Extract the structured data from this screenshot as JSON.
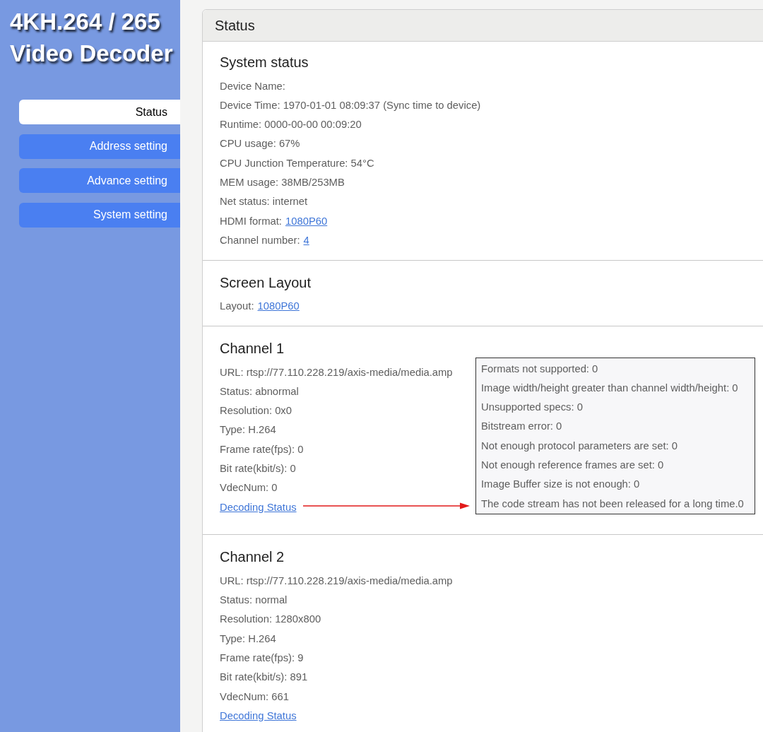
{
  "sidebar": {
    "title_lines": [
      "4KH.264 / 265",
      "Video Decoder"
    ],
    "items": [
      {
        "label": "Status",
        "selected": true
      },
      {
        "label": "Address setting",
        "selected": false
      },
      {
        "label": "Advance setting",
        "selected": false
      },
      {
        "label": "System setting",
        "selected": false
      }
    ]
  },
  "panel": {
    "title": "Status",
    "sections": [
      {
        "heading": "System status",
        "rows": [
          {
            "kind": "text",
            "text": "Device Name:"
          },
          {
            "kind": "text",
            "text": "Device Time: 1970-01-01 08:09:37 (Sync time to device)"
          },
          {
            "kind": "text",
            "text": "Runtime: 0000-00-00 00:09:20"
          },
          {
            "kind": "text",
            "text": "CPU usage: 67%"
          },
          {
            "kind": "text",
            "text": "CPU Junction Temperature: 54°C"
          },
          {
            "kind": "text",
            "text": "MEM usage: 38MB/253MB"
          },
          {
            "kind": "text",
            "text": "Net status: internet"
          },
          {
            "kind": "labeled_link",
            "label": "HDMI format:",
            "link": "1080P60"
          },
          {
            "kind": "labeled_link",
            "label": "Channel number:",
            "link": "4"
          }
        ]
      },
      {
        "heading": "Screen Layout",
        "rows": [
          {
            "kind": "labeled_link",
            "label": "Layout:",
            "link": "1080P60"
          }
        ]
      },
      {
        "heading": "Channel 1",
        "rows": [
          {
            "kind": "text",
            "text": "URL: rtsp://77.110.228.219/axis-media/media.amp"
          },
          {
            "kind": "text",
            "text": "Status: abnormal"
          },
          {
            "kind": "text",
            "text": "Resolution: 0x0"
          },
          {
            "kind": "text",
            "text": "Type: H.264"
          },
          {
            "kind": "text",
            "text": "Frame rate(fps): 0"
          },
          {
            "kind": "text",
            "text": "Bit rate(kbit/s): 0"
          },
          {
            "kind": "text",
            "text": "VdecNum: 0"
          },
          {
            "kind": "link",
            "link": "Decoding Status"
          }
        ],
        "decoding_popup": {
          "lines": [
            "Formats not supported: 0",
            "Image width/height greater than channel width/height: 0",
            "Unsupported specs: 0",
            "Bitstream error: 0",
            "Not enough protocol parameters are set: 0",
            "Not enough reference frames are set: 0",
            "Image Buffer size is not enough: 0",
            "The code stream has not been released for a long time.0"
          ]
        }
      },
      {
        "heading": "Channel 2",
        "rows": [
          {
            "kind": "text",
            "text": "URL: rtsp://77.110.228.219/axis-media/media.amp"
          },
          {
            "kind": "text",
            "text": "Status: normal"
          },
          {
            "kind": "text",
            "text": "Resolution: 1280x800"
          },
          {
            "kind": "text",
            "text": "Type: H.264"
          },
          {
            "kind": "text",
            "text": "Frame rate(fps): 9"
          },
          {
            "kind": "text",
            "text": "Bit rate(kbit/s): 891"
          },
          {
            "kind": "text",
            "text": "VdecNum: 661"
          },
          {
            "kind": "link",
            "link": "Decoding Status"
          }
        ]
      }
    ]
  }
}
